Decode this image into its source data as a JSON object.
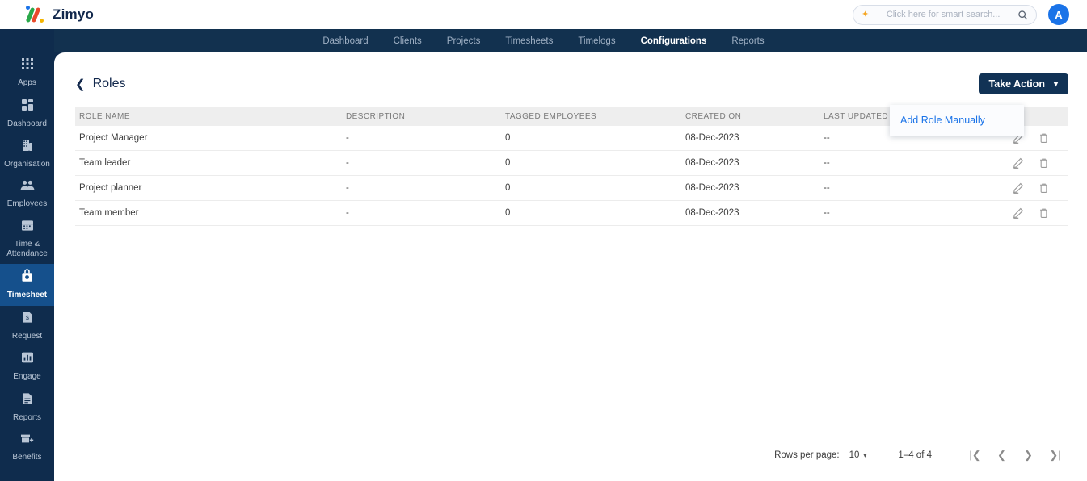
{
  "app": {
    "brand": "Zimyo",
    "logo_icon": "zimyo-percent-logo"
  },
  "search": {
    "placeholder": "Click here for smart search...",
    "value": "",
    "sparkle_icon": "sparkle-icon",
    "search_icon": "search-icon"
  },
  "user": {
    "avatar_initial": "A"
  },
  "topnav": {
    "items": [
      {
        "label": "Dashboard",
        "active": false
      },
      {
        "label": "Clients",
        "active": false
      },
      {
        "label": "Projects",
        "active": false
      },
      {
        "label": "Timesheets",
        "active": false
      },
      {
        "label": "Timelogs",
        "active": false
      },
      {
        "label": "Configurations",
        "active": true
      },
      {
        "label": "Reports",
        "active": false
      }
    ]
  },
  "sidebar": {
    "items": [
      {
        "label": "Apps",
        "icon": "apps-grid-icon",
        "active": false
      },
      {
        "label": "Dashboard",
        "icon": "dashboard-squares-icon",
        "active": false
      },
      {
        "label": "Organisation",
        "icon": "building-icon",
        "active": false
      },
      {
        "label": "Employees",
        "icon": "people-icon",
        "active": false
      },
      {
        "label": "Time & Attendance",
        "icon": "calendar-icon",
        "active": false
      },
      {
        "label": "Timesheet",
        "icon": "timesheet-lock-icon",
        "active": true
      },
      {
        "label": "Request",
        "icon": "request-document-icon",
        "active": false
      },
      {
        "label": "Engage",
        "icon": "bar-chart-icon",
        "active": false
      },
      {
        "label": "Reports",
        "icon": "report-document-icon",
        "active": false
      },
      {
        "label": "Benefits",
        "icon": "benefits-cart-icon",
        "active": false
      }
    ]
  },
  "page": {
    "title": "Roles",
    "back_icon": "chevron-left-icon",
    "action_button": {
      "label": "Take Action",
      "icon": "chevron-down-icon"
    },
    "dropdown": {
      "open": true,
      "items": [
        {
          "label": "Add Role Manually"
        }
      ]
    }
  },
  "table": {
    "columns": [
      "ROLE NAME",
      "DESCRIPTION",
      "TAGGED EMPLOYEES",
      "CREATED ON",
      "LAST UPDATED ON",
      ""
    ],
    "row_icons": {
      "edit": "edit-pencil-icon",
      "delete": "delete-trash-icon"
    },
    "rows": [
      {
        "name": "Project Manager",
        "description": "-",
        "tagged": "0",
        "created": "08-Dec-2023",
        "updated": "--"
      },
      {
        "name": "Team leader",
        "description": "-",
        "tagged": "0",
        "created": "08-Dec-2023",
        "updated": "--"
      },
      {
        "name": "Project planner",
        "description": "-",
        "tagged": "0",
        "created": "08-Dec-2023",
        "updated": "--"
      },
      {
        "name": "Team member",
        "description": "-",
        "tagged": "0",
        "created": "08-Dec-2023",
        "updated": "--"
      }
    ]
  },
  "pagination": {
    "rows_per_page_label": "Rows per page:",
    "rows_per_page_value": "10",
    "range": "1–4 of 4",
    "first_icon": "first-page-icon",
    "prev_icon": "previous-page-icon",
    "next_icon": "next-page-icon",
    "last_icon": "last-page-icon"
  },
  "colors": {
    "navy": "#0f2c4d",
    "nav_strip": "#12314f",
    "accent_blue": "#1a73e8",
    "active_side": "#15508c",
    "button_navy": "#113255",
    "header_gray": "#eeeeee"
  }
}
